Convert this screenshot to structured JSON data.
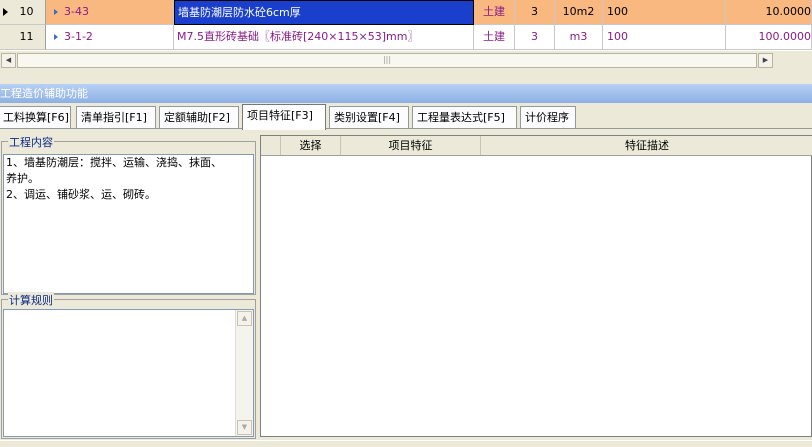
{
  "grid": {
    "rows": [
      {
        "num": "10",
        "code": "3-43",
        "name": "墙基防潮层防水砼6cm厚",
        "category": "土建",
        "qty_type": "3",
        "unit": "10m2",
        "rate": "100",
        "amount": "10.0000"
      },
      {
        "num": "11",
        "code": "3-1-2",
        "name": "M7.5直形砖基础〖标准砖[240×115×53]mm〗",
        "category": "土建",
        "qty_type": "3",
        "unit": "m3",
        "rate": "100",
        "amount": "100.0000"
      }
    ]
  },
  "panel": {
    "title": "工程造价辅助功能",
    "tabs": [
      "工料换算[F6]",
      "清单指引[F1]",
      "定额辅助[F2]",
      "项目特征[F3]",
      "类别设置[F4]",
      "工程量表达式[F5]",
      "计价程序"
    ],
    "active_tab": "项目特征[F3]"
  },
  "work_content": {
    "title": "工程内容",
    "lines": [
      "1、墙基防潮层：搅拌、运输、浇捣、抹面、",
      "养护。",
      "2、调运、铺砂浆、运、砌砖。"
    ]
  },
  "calc_rules": {
    "title": "计算规则"
  },
  "feature_table": {
    "columns": [
      "选择",
      "项目特征",
      "特征描述"
    ]
  },
  "colors": {
    "selected_row": "#f8b880",
    "selected_cell": "#1a3fcc",
    "code_text": "#8a1a8a",
    "panel_title": "#8cb0e4"
  }
}
